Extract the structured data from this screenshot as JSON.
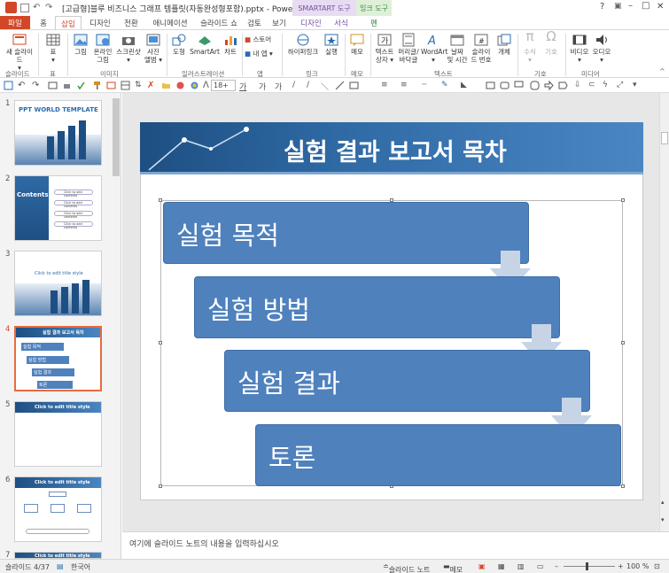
{
  "window": {
    "title": "[고급형]블루 비즈니스 그래프 템플릿(자동완성형포함).pptx - PowerPoint",
    "help": "?",
    "min": "–",
    "max": "□",
    "close": "✕"
  },
  "context_tabs": {
    "smartart": "SMARTART 도구",
    "ink": "잉크 도구"
  },
  "tabs": [
    "파일",
    "홈",
    "삽입",
    "디자인",
    "전환",
    "애니메이션",
    "슬라이드 쇼",
    "검토",
    "보기",
    "디자인",
    "서식",
    "펜"
  ],
  "ribbon": {
    "buttons": [
      {
        "label": "새 슬라이드",
        "sub": "▾"
      },
      {
        "label": "표",
        "sub": "▾"
      },
      {
        "label": "그림"
      },
      {
        "label": "온라인",
        "sub": "그림"
      },
      {
        "label": "스크린샷",
        "sub": "▾"
      },
      {
        "label": "사진",
        "sub": "앨범 ▾"
      },
      {
        "label": "도형"
      },
      {
        "label": "SmartArt"
      },
      {
        "label": "차트"
      },
      {
        "label": "스토어"
      },
      {
        "label": "내 앱 ▾"
      },
      {
        "label": "하이퍼링크"
      },
      {
        "label": "실행"
      },
      {
        "label": "메모"
      },
      {
        "label": "텍스트",
        "sub": "상자 ▾"
      },
      {
        "label": "머리글/",
        "sub": "바닥글"
      },
      {
        "label": "WordArt",
        "sub": "▾"
      },
      {
        "label": "날짜",
        "sub": "및 시간"
      },
      {
        "label": "슬라이",
        "sub": "드 번호"
      },
      {
        "label": "개체"
      },
      {
        "label": "수식",
        "sub": "▾"
      },
      {
        "label": "기호"
      },
      {
        "label": "비디오",
        "sub": "▾"
      },
      {
        "label": "오디오",
        "sub": "▾"
      }
    ],
    "groups": [
      "슬라이드",
      "표",
      "이미지",
      "일러스트레이션",
      "앱",
      "링크",
      "메모",
      "텍스트",
      "기호",
      "미디어"
    ]
  },
  "qat": {
    "font_size": "18+"
  },
  "thumbnails": [
    {
      "num": "1",
      "label": "PPT WORLD TEMPLATE"
    },
    {
      "num": "2",
      "label": "Contents"
    },
    {
      "num": "3",
      "label": "Click to edit title style"
    },
    {
      "num": "4",
      "label": "실험 결과 보고서 목차"
    },
    {
      "num": "5",
      "label": "Click to edit title style"
    },
    {
      "num": "6",
      "label": "Click to edit title style"
    },
    {
      "num": "7",
      "label": "Click to edit title style"
    }
  ],
  "thumb2_items": [
    "Click to add contents",
    "Click to add contents",
    "Click to add contents",
    "Click to add contents"
  ],
  "thumb4_items": [
    "실험 목적",
    "실험 방법",
    "실험 결과",
    "토론"
  ],
  "slide": {
    "title": "실험 결과 보고서 목차",
    "steps": [
      "실험 목적",
      "실험 방법",
      "실험 결과",
      "토론"
    ]
  },
  "notes": {
    "placeholder": "여기에 슬라이드 노트의 내용을 입력하십시오"
  },
  "status": {
    "slide": "슬라이드 4/37",
    "lang": "한국어",
    "notes": "슬라이드 노트",
    "comments": "메모",
    "zoom": "100 %"
  },
  "colors": {
    "accent": "#d24726",
    "step_fill": "#4f81bd",
    "banner": "#2f6aa5"
  }
}
